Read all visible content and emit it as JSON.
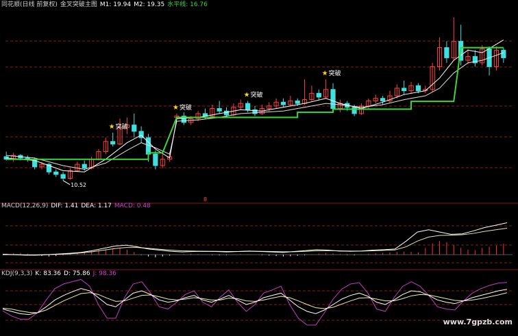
{
  "colors": {
    "bg": "#000000",
    "grid": "#8b1a1a",
    "up": "#ff4040",
    "down": "#40e0e0",
    "ma1": "#ffffff",
    "ma2": "#e0e0e0",
    "level": "#39d939",
    "dif": "#ffffff",
    "dea": "#e8e8b0",
    "macd_pos": "#ff3030",
    "macd_neg": "#ffffff",
    "k": "#ffffff",
    "d": "#f0f0a0",
    "j": "#c040c0",
    "star": "#ffd700"
  },
  "main_panel": {
    "title": "同花顺(日线 前复权)",
    "indicator": "金叉突破主图",
    "m1_label": "M1: 19.94",
    "m2_label": "M2: 19.35",
    "level_label": "水平线: 16.76",
    "low_annotation": "10.52",
    "marker_label": "突破",
    "mid_marker": "8"
  },
  "macd_panel": {
    "title": "MACD(12,26,9)",
    "dif_label": "DIF: 1.41",
    "dea_label": "DEA: 1.17",
    "macd_label": "MACD: 0.48"
  },
  "kdj_panel": {
    "title": "KDJ(9,3,3)",
    "k_label": "K: 83.36",
    "d_label": "D: 75.86",
    "j_label": "J: 98.36"
  },
  "watermark": "www.7gpzb.com",
  "chart_data": [
    {
      "type": "candlestick",
      "ylim": [
        9,
        24
      ],
      "candles": [
        [
          12.4,
          12.2,
          12.8,
          12.1
        ],
        [
          12.2,
          12.5,
          12.7,
          12.0
        ],
        [
          12.5,
          12.3,
          12.6,
          12.1
        ],
        [
          12.3,
          12.2,
          12.5,
          12.0
        ],
        [
          12.2,
          11.6,
          12.3,
          11.4
        ],
        [
          11.6,
          11.8,
          12.0,
          11.4
        ],
        [
          11.8,
          11.2,
          11.9,
          11.0
        ],
        [
          11.2,
          11.0,
          11.4,
          10.8
        ],
        [
          11.0,
          10.7,
          11.2,
          10.52
        ],
        [
          10.7,
          11.3,
          11.5,
          10.6
        ],
        [
          11.3,
          11.8,
          12.0,
          11.2
        ],
        [
          11.8,
          11.5,
          12.1,
          11.3
        ],
        [
          11.5,
          12.2,
          12.4,
          11.4
        ],
        [
          12.2,
          12.8,
          13.0,
          12.1
        ],
        [
          12.8,
          13.6,
          13.9,
          12.6
        ],
        [
          13.6,
          13.4,
          14.3,
          13.2
        ],
        [
          13.4,
          14.7,
          15.4,
          13.3
        ],
        [
          14.7,
          14.9,
          15.5,
          14.2
        ],
        [
          14.9,
          14.4,
          15.8,
          13.9
        ],
        [
          14.4,
          13.9,
          14.8,
          13.5
        ],
        [
          13.9,
          12.6,
          14.2,
          12.0
        ],
        [
          12.6,
          11.7,
          12.9,
          11.4
        ],
        [
          11.7,
          12.2,
          12.6,
          11.5
        ],
        [
          12.2,
          12.4,
          12.8,
          12.0
        ],
        [
          15.5,
          15.6,
          15.8,
          15.3
        ],
        [
          15.6,
          15.1,
          15.9,
          14.9
        ],
        [
          15.1,
          15.4,
          15.6,
          14.9
        ],
        [
          15.4,
          15.8,
          16.0,
          15.2
        ],
        [
          15.8,
          15.6,
          16.2,
          15.4
        ],
        [
          15.6,
          16.2,
          16.5,
          15.5
        ],
        [
          16.2,
          16.0,
          16.8,
          15.8
        ],
        [
          16.0,
          15.7,
          16.3,
          15.5
        ],
        [
          15.7,
          16.3,
          16.6,
          15.6
        ],
        [
          16.3,
          16.6,
          16.9,
          16.1
        ],
        [
          16.6,
          16.1,
          16.8,
          15.9
        ],
        [
          16.1,
          15.8,
          16.4,
          15.6
        ],
        [
          15.8,
          16.2,
          16.5,
          15.7
        ],
        [
          16.2,
          16.4,
          16.7,
          16.0
        ],
        [
          16.4,
          16.7,
          17.0,
          16.2
        ],
        [
          16.7,
          16.5,
          17.0,
          16.3
        ],
        [
          16.5,
          16.8,
          17.2,
          16.4
        ],
        [
          16.8,
          16.6,
          17.0,
          16.4
        ],
        [
          16.6,
          16.9,
          18.5,
          16.5
        ],
        [
          16.9,
          17.4,
          18.0,
          16.8
        ],
        [
          17.4,
          17.1,
          17.7,
          16.9
        ],
        [
          17.1,
          17.7,
          18.5,
          17.0
        ],
        [
          17.7,
          16.2,
          18.2,
          16.0
        ],
        [
          16.2,
          16.6,
          16.9,
          15.9
        ],
        [
          16.6,
          16.3,
          16.8,
          16.0
        ],
        [
          16.3,
          15.8,
          16.5,
          15.6
        ],
        [
          15.8,
          16.4,
          16.6,
          15.7
        ],
        [
          16.4,
          16.8,
          17.0,
          16.2
        ],
        [
          16.8,
          17.0,
          17.3,
          16.6
        ],
        [
          17.0,
          16.8,
          17.2,
          16.5
        ],
        [
          16.8,
          17.2,
          17.6,
          16.6
        ],
        [
          17.2,
          17.8,
          18.1,
          17.0
        ],
        [
          17.8,
          17.6,
          18.4,
          17.3
        ],
        [
          17.6,
          18.0,
          18.3,
          17.4
        ],
        [
          18.0,
          17.6,
          18.2,
          17.4
        ],
        [
          17.6,
          17.7,
          18.0,
          17.4
        ],
        [
          17.7,
          19.5,
          19.8,
          17.5
        ],
        [
          19.5,
          21.0,
          21.8,
          19.2
        ],
        [
          21.0,
          20.2,
          21.5,
          19.8
        ],
        [
          20.2,
          21.5,
          23.4,
          20.0
        ],
        [
          21.5,
          20.0,
          22.8,
          19.6
        ],
        [
          20.0,
          20.3,
          20.9,
          19.7
        ],
        [
          20.3,
          19.8,
          20.8,
          19.5
        ],
        [
          19.8,
          20.9,
          21.2,
          19.6
        ],
        [
          20.9,
          19.5,
          21.1,
          18.8
        ],
        [
          19.5,
          20.8,
          21.1,
          19.2
        ],
        [
          20.8,
          20.2,
          21.0,
          19.8
        ]
      ],
      "level_line": [
        [
          0,
          12.2
        ],
        [
          20,
          12.2
        ],
        [
          20,
          12.7
        ],
        [
          22,
          12.7
        ],
        [
          24,
          15.5
        ],
        [
          41,
          15.5
        ],
        [
          41,
          15.9
        ],
        [
          46,
          15.9
        ],
        [
          46,
          16.15
        ],
        [
          57,
          16.15
        ],
        [
          57,
          16.76
        ],
        [
          63,
          16.76
        ],
        [
          64,
          21.0
        ],
        [
          70,
          21.0
        ]
      ],
      "m1_line": [
        [
          0,
          12.3
        ],
        [
          4,
          12.1
        ],
        [
          8,
          11.3
        ],
        [
          11,
          11.2
        ],
        [
          14,
          12.2
        ],
        [
          17,
          13.5
        ],
        [
          19,
          14.1
        ],
        [
          21,
          13.0
        ],
        [
          23,
          12.3
        ],
        [
          24,
          15.4
        ],
        [
          27,
          15.5
        ],
        [
          30,
          15.8
        ],
        [
          33,
          16.1
        ],
        [
          36,
          16.0
        ],
        [
          39,
          16.3
        ],
        [
          42,
          16.6
        ],
        [
          45,
          17.0
        ],
        [
          47,
          16.6
        ],
        [
          50,
          16.2
        ],
        [
          53,
          16.7
        ],
        [
          56,
          17.3
        ],
        [
          59,
          17.6
        ],
        [
          61,
          18.6
        ],
        [
          63,
          20.0
        ],
        [
          65,
          20.8
        ],
        [
          67,
          20.6
        ],
        [
          70,
          21.6
        ]
      ],
      "m2_line": [
        [
          0,
          12.5
        ],
        [
          4,
          12.3
        ],
        [
          8,
          11.7
        ],
        [
          11,
          11.4
        ],
        [
          14,
          11.9
        ],
        [
          17,
          12.9
        ],
        [
          19,
          13.5
        ],
        [
          21,
          13.1
        ],
        [
          23,
          12.6
        ],
        [
          24,
          15.2
        ],
        [
          27,
          15.3
        ],
        [
          30,
          15.5
        ],
        [
          33,
          15.8
        ],
        [
          36,
          15.9
        ],
        [
          39,
          16.0
        ],
        [
          42,
          16.3
        ],
        [
          45,
          16.6
        ],
        [
          47,
          16.5
        ],
        [
          50,
          16.3
        ],
        [
          53,
          16.5
        ],
        [
          56,
          16.9
        ],
        [
          59,
          17.2
        ],
        [
          61,
          17.8
        ],
        [
          63,
          19.0
        ],
        [
          65,
          19.8
        ],
        [
          67,
          20.0
        ],
        [
          70,
          20.6
        ]
      ],
      "breakout_markers": [
        15,
        24,
        34,
        45
      ]
    },
    {
      "type": "macd",
      "ylim": [
        -0.6,
        2.0
      ],
      "histogram": [
        0.05,
        0.06,
        0.08,
        0.05,
        -0.04,
        -0.06,
        -0.08,
        -0.06,
        -0.02,
        0.04,
        0.08,
        0.12,
        0.16,
        0.2,
        0.24,
        0.28,
        0.3,
        0.22,
        0.12,
        -0.02,
        -0.08,
        -0.12,
        -0.08,
        -0.04,
        0.02,
        0.03,
        0.04,
        0.03,
        0.02,
        -0.02,
        -0.03,
        -0.02,
        0.02,
        0.03,
        0.02,
        0.01,
        -0.02,
        -0.04,
        -0.06,
        -0.08,
        -0.07,
        -0.05,
        -0.03,
        0.02,
        0.05,
        0.08,
        0.06,
        0.03,
        -0.02,
        -0.03,
        0.02,
        0.04,
        0.06,
        0.08,
        0.1,
        0.12,
        0.14,
        0.12,
        0.1,
        0.3,
        0.5,
        0.6,
        0.55,
        0.42,
        0.3,
        0.22,
        0.2,
        0.3,
        0.35,
        0.4,
        0.48
      ],
      "dif": [
        0.02,
        0.0,
        -0.02,
        -0.02,
        0.0,
        0.03,
        0.06,
        0.1,
        0.18,
        0.28,
        0.38,
        0.42,
        0.35,
        0.25,
        0.2,
        0.15,
        0.12,
        0.14,
        0.15,
        0.14,
        0.12,
        0.14,
        0.16,
        0.14,
        0.12,
        0.1,
        0.14,
        0.18,
        0.22,
        0.2,
        0.16,
        0.15,
        0.16,
        0.2,
        0.22,
        0.25,
        0.6,
        1.0,
        1.1,
        1.0,
        0.9,
        0.92,
        1.05,
        1.2,
        1.3,
        1.41
      ],
      "dea": [
        0.0,
        0.0,
        -0.01,
        -0.01,
        0.0,
        0.02,
        0.04,
        0.08,
        0.13,
        0.2,
        0.27,
        0.32,
        0.32,
        0.28,
        0.24,
        0.2,
        0.17,
        0.16,
        0.15,
        0.15,
        0.14,
        0.14,
        0.15,
        0.15,
        0.14,
        0.13,
        0.13,
        0.15,
        0.17,
        0.18,
        0.17,
        0.16,
        0.16,
        0.17,
        0.19,
        0.21,
        0.35,
        0.6,
        0.78,
        0.85,
        0.86,
        0.88,
        0.94,
        1.03,
        1.1,
        1.17
      ]
    },
    {
      "type": "kdj",
      "ylim": [
        -10,
        110
      ],
      "k": [
        40,
        35,
        30,
        28,
        32,
        45,
        60,
        70,
        78,
        85,
        80,
        65,
        50,
        45,
        60,
        75,
        80,
        72,
        60,
        55,
        58,
        65,
        70,
        60,
        55,
        62,
        70,
        60,
        50,
        55,
        65,
        70,
        75,
        60,
        45,
        35,
        30,
        38,
        50,
        62,
        70,
        75,
        68,
        55,
        50,
        60,
        72,
        80,
        78,
        70,
        60,
        55,
        52,
        58,
        65,
        70,
        75,
        80,
        83.36
      ],
      "d": [
        42,
        40,
        36,
        33,
        32,
        38,
        48,
        58,
        66,
        74,
        76,
        72,
        64,
        57,
        58,
        64,
        70,
        71,
        67,
        62,
        60,
        62,
        65,
        63,
        60,
        60,
        64,
        63,
        58,
        57,
        60,
        64,
        68,
        65,
        58,
        50,
        43,
        41,
        44,
        51,
        58,
        64,
        65,
        62,
        58,
        58,
        63,
        69,
        72,
        71,
        67,
        63,
        59,
        58,
        60,
        63,
        67,
        71,
        75.86
      ],
      "j": [
        36,
        25,
        18,
        18,
        32,
        60,
        85,
        95,
        100,
        105,
        90,
        50,
        20,
        20,
        65,
        95,
        100,
        75,
        45,
        40,
        55,
        72,
        80,
        55,
        45,
        66,
        82,
        55,
        35,
        50,
        75,
        82,
        90,
        50,
        20,
        5,
        5,
        32,
        62,
        84,
        95,
        98,
        75,
        40,
        35,
        65,
        90,
        100,
        90,
        70,
        45,
        40,
        38,
        58,
        75,
        85,
        92,
        97,
        98.36
      ]
    }
  ]
}
